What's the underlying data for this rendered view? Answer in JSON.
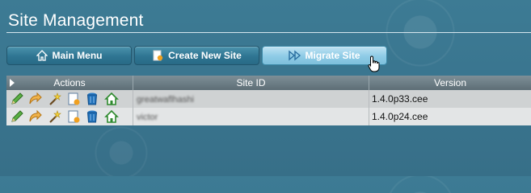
{
  "header": {
    "title": "Site Management"
  },
  "toolbar": {
    "main_menu_label": "Main Menu",
    "create_site_label": "Create New Site",
    "migrate_site_label": "Migrate Site"
  },
  "table": {
    "columns": [
      "Actions",
      "Site ID",
      "Version"
    ],
    "rows": [
      {
        "site_id": "greatwaflhashi",
        "version": "1.4.0p33.cee"
      },
      {
        "site_id": "victor",
        "version": "1.4.0p24.cee"
      }
    ],
    "action_icons": [
      "edit-pencil-icon",
      "clone-arrow-icon",
      "magic-wand-icon",
      "document-icon",
      "trash-icon",
      "home-icon"
    ]
  },
  "colors": {
    "background": "#3a7690",
    "button": "#2f7592",
    "button_active": "#8ecbe6",
    "header_row": "#6b7b83"
  }
}
